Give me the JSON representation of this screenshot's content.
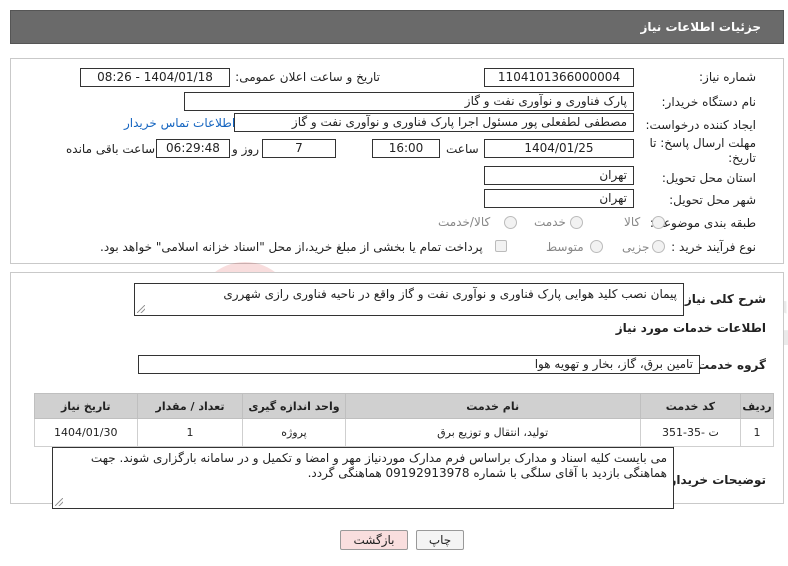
{
  "header": {
    "title": "جزئیات اطلاعات نیاز"
  },
  "need": {
    "number_label": "شماره نیاز:",
    "number_value": "1104101366000004",
    "announce_label": "تاریخ و ساعت اعلان عمومی:",
    "announce_value": "1404/01/18 - 08:26",
    "buyer_label": "نام دستگاه خریدار:",
    "buyer_value": "پارک فناوری و نوآوری نفت و گاز",
    "creator_label": "ایجاد کننده درخواست:",
    "creator_value": "مصطفی لطفعلی پور مسئول اجرا پارک فناوری و نوآوری نفت و گاز",
    "contact_link": "اطلاعات تماس خریدار",
    "deadline_label": "مهلت ارسال پاسخ: تا تاریخ:",
    "deadline_date": "1404/01/25",
    "time_label": "ساعت",
    "deadline_time": "16:00",
    "days_value": "7",
    "days_label": "روز و",
    "remaining_value": "06:29:48",
    "remaining_label": "ساعت باقی مانده",
    "province_label": "استان محل تحویل:",
    "province_value": "تهران",
    "city_label": "شهر محل تحویل:",
    "city_value": "تهران",
    "category_label": "طبقه بندی موضوعی:",
    "category_options": [
      "کالا",
      "خدمت",
      "کالا/خدمت"
    ],
    "process_label": "نوع فرآیند خرید :",
    "process_options": [
      "جزیی",
      "متوسط"
    ],
    "payment_note": "پرداخت تمام یا بخشی از مبلغ خرید،از محل \"اسناد خزانه اسلامی\" خواهد بود."
  },
  "summary": {
    "label": "شرح کلی نیاز:",
    "value": "پیمان نصب کلید هوایی پارک فناوری و نوآوری نفت و گاز واقع در ناحیه فناوری رازی شهرری"
  },
  "services": {
    "section_title": "اطلاعات خدمات مورد نیاز",
    "group_label": "گروه خدمت:",
    "group_value": "تامین برق، گاز، بخار و تهویه هوا",
    "columns": [
      "ردیف",
      "کد خدمت",
      "نام خدمت",
      "واحد اندازه گیری",
      "تعداد / مقدار",
      "تاریخ نیاز"
    ],
    "rows": [
      [
        "1",
        "ت -35-351",
        "تولید، انتقال و توزیع برق",
        "پروژه",
        "1",
        "1404/01/30"
      ]
    ]
  },
  "buyer_notes": {
    "label": "توضیحات خریدار:",
    "value": "می بایست کلیه اسناد و مدارک براساس فرم مدارک موردنیاز مهر و امضا و تکمیل و در سامانه بارگزاری شوند. جهت هماهنگی بازدید با آقای سلگی با شماره 09192913978 هماهنگی گردد."
  },
  "buttons": {
    "print": "چاپ",
    "back": "بازگشت"
  },
  "colors": {
    "header_bg": "#6a6a6a",
    "link": "#1565c0",
    "back_button_bg": "#f9dede"
  }
}
